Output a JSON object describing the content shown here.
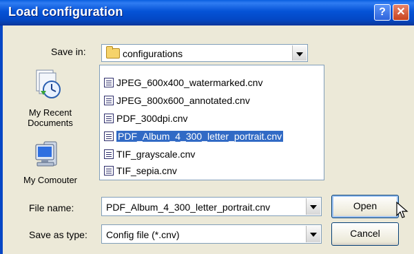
{
  "window": {
    "title": "Load configuration",
    "help_glyph": "?",
    "close_glyph": "✕"
  },
  "save_in": {
    "label": "Save in:",
    "value": "configurations",
    "icon": "folder-icon"
  },
  "places": [
    {
      "label": "My Recent Documents",
      "icon": "recent-documents-icon"
    },
    {
      "label": "My Comouter",
      "icon": "my-computer-icon"
    }
  ],
  "files": [
    {
      "name": "JPEG_600x400_watermarked.cnv",
      "selected": false
    },
    {
      "name": "JPEG_800x600_annotated.cnv",
      "selected": false
    },
    {
      "name": "PDF_300dpi.cnv",
      "selected": false
    },
    {
      "name": "PDF_Album_4_300_letter_portrait.cnv",
      "selected": true
    },
    {
      "name": "TIF_grayscale.cnv",
      "selected": false
    },
    {
      "name": "TIF_sepia.cnv",
      "selected": false
    }
  ],
  "file_name": {
    "label": "File name:",
    "value": "PDF_Album_4_300_letter_portrait.cnv"
  },
  "save_as_type": {
    "label": "Save as type:",
    "value": "Config file (*.cnv)"
  },
  "buttons": {
    "open": "Open",
    "cancel": "Cancel"
  },
  "colors": {
    "titlebar": "#0553d7",
    "selection": "#316ac5",
    "dialog_bg": "#ece9d8",
    "close_button": "#c8421d"
  }
}
